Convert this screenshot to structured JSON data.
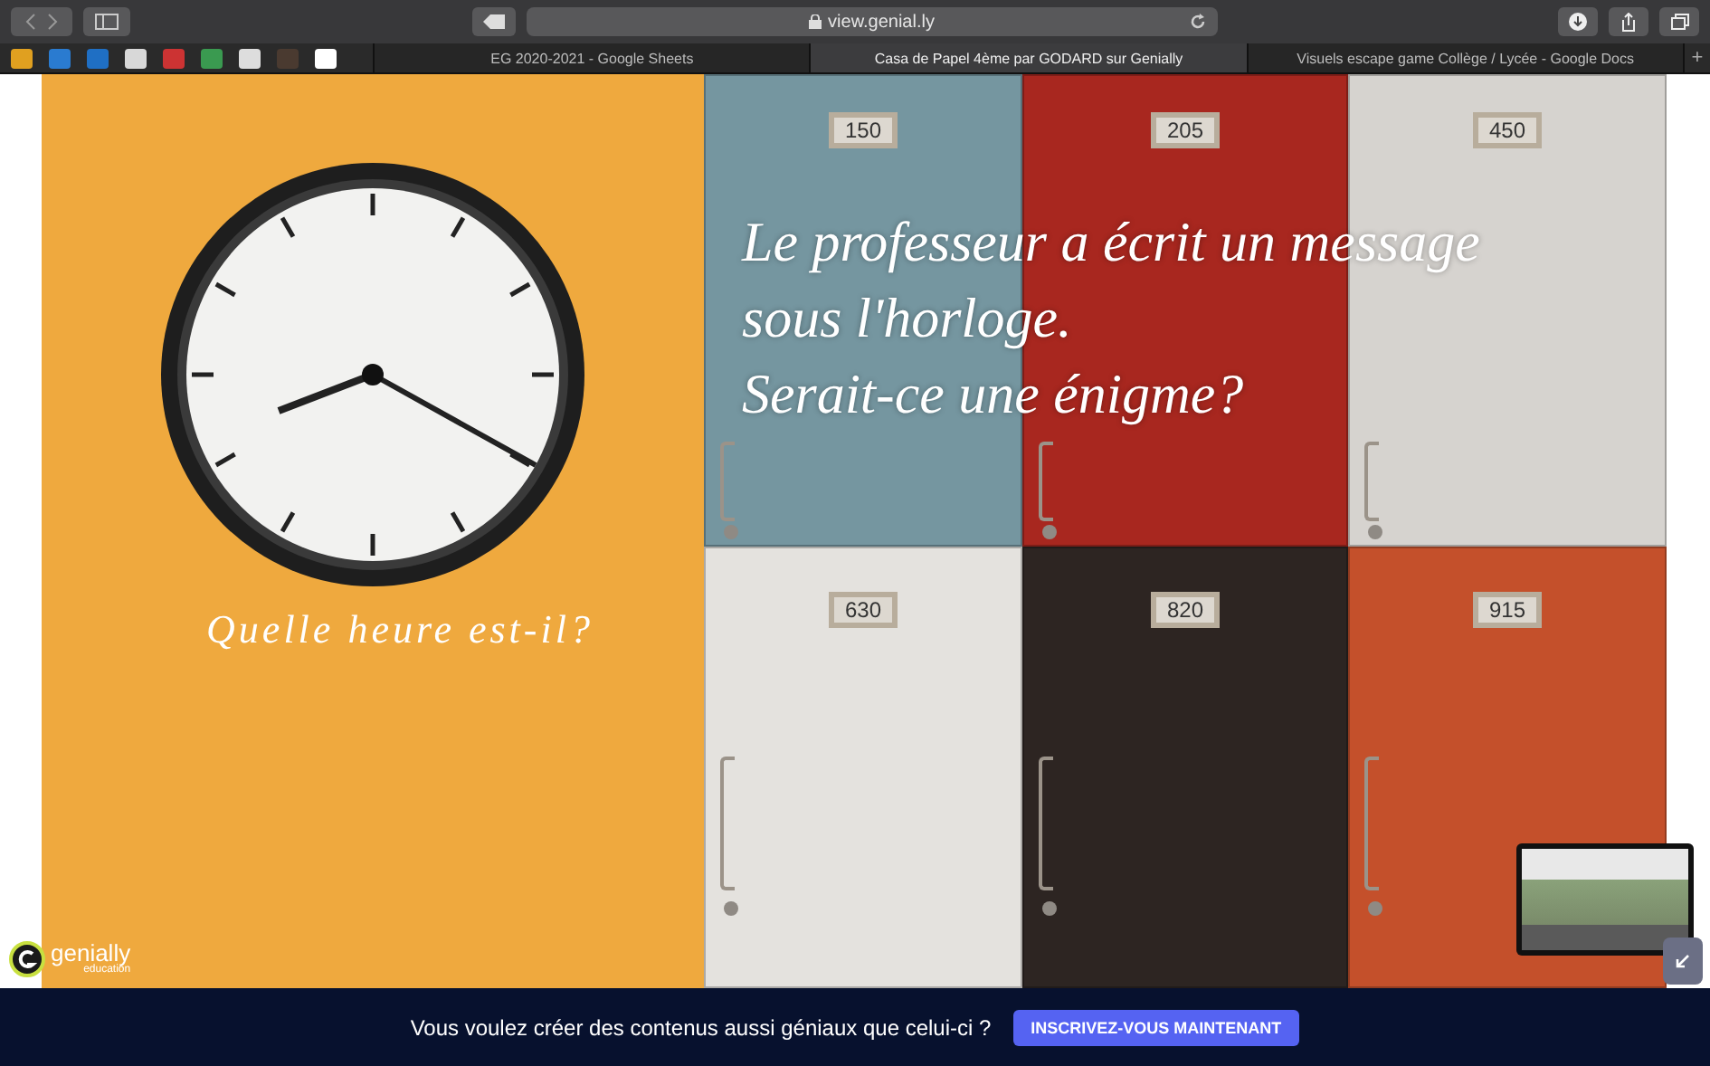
{
  "browser": {
    "url": "view.genial.ly",
    "tabs": [
      {
        "label": "EG 2020-2021 - Google Sheets",
        "selected": false
      },
      {
        "label": "Casa de Papel 4ème par GODARD sur Genially",
        "selected": true
      },
      {
        "label": "Visuels escape game Collège / Lycée - Google Docs",
        "selected": false
      }
    ],
    "new_tab": "+"
  },
  "slide": {
    "clock_caption": "Quelle heure est-il?",
    "message_lines": [
      "Le professeur a écrit un message",
      "sous l'horloge.",
      "Serait-ce une énigme?"
    ],
    "lockers": [
      {
        "number": "150",
        "color": "#7596a0"
      },
      {
        "number": "205",
        "color": "#a8271f"
      },
      {
        "number": "450",
        "color": "#d6d3cf"
      },
      {
        "number": "630",
        "color": "#e4e2de"
      },
      {
        "number": "820",
        "color": "#2d2522"
      },
      {
        "number": "915",
        "color": "#c4502b"
      }
    ]
  },
  "logo": {
    "name": "genially",
    "subtitle": "education"
  },
  "banner": {
    "text": "Vous voulez créer des contenus aussi géniaux que celui-ci ?",
    "button": "INSCRIVEZ-VOUS MAINTENANT"
  }
}
